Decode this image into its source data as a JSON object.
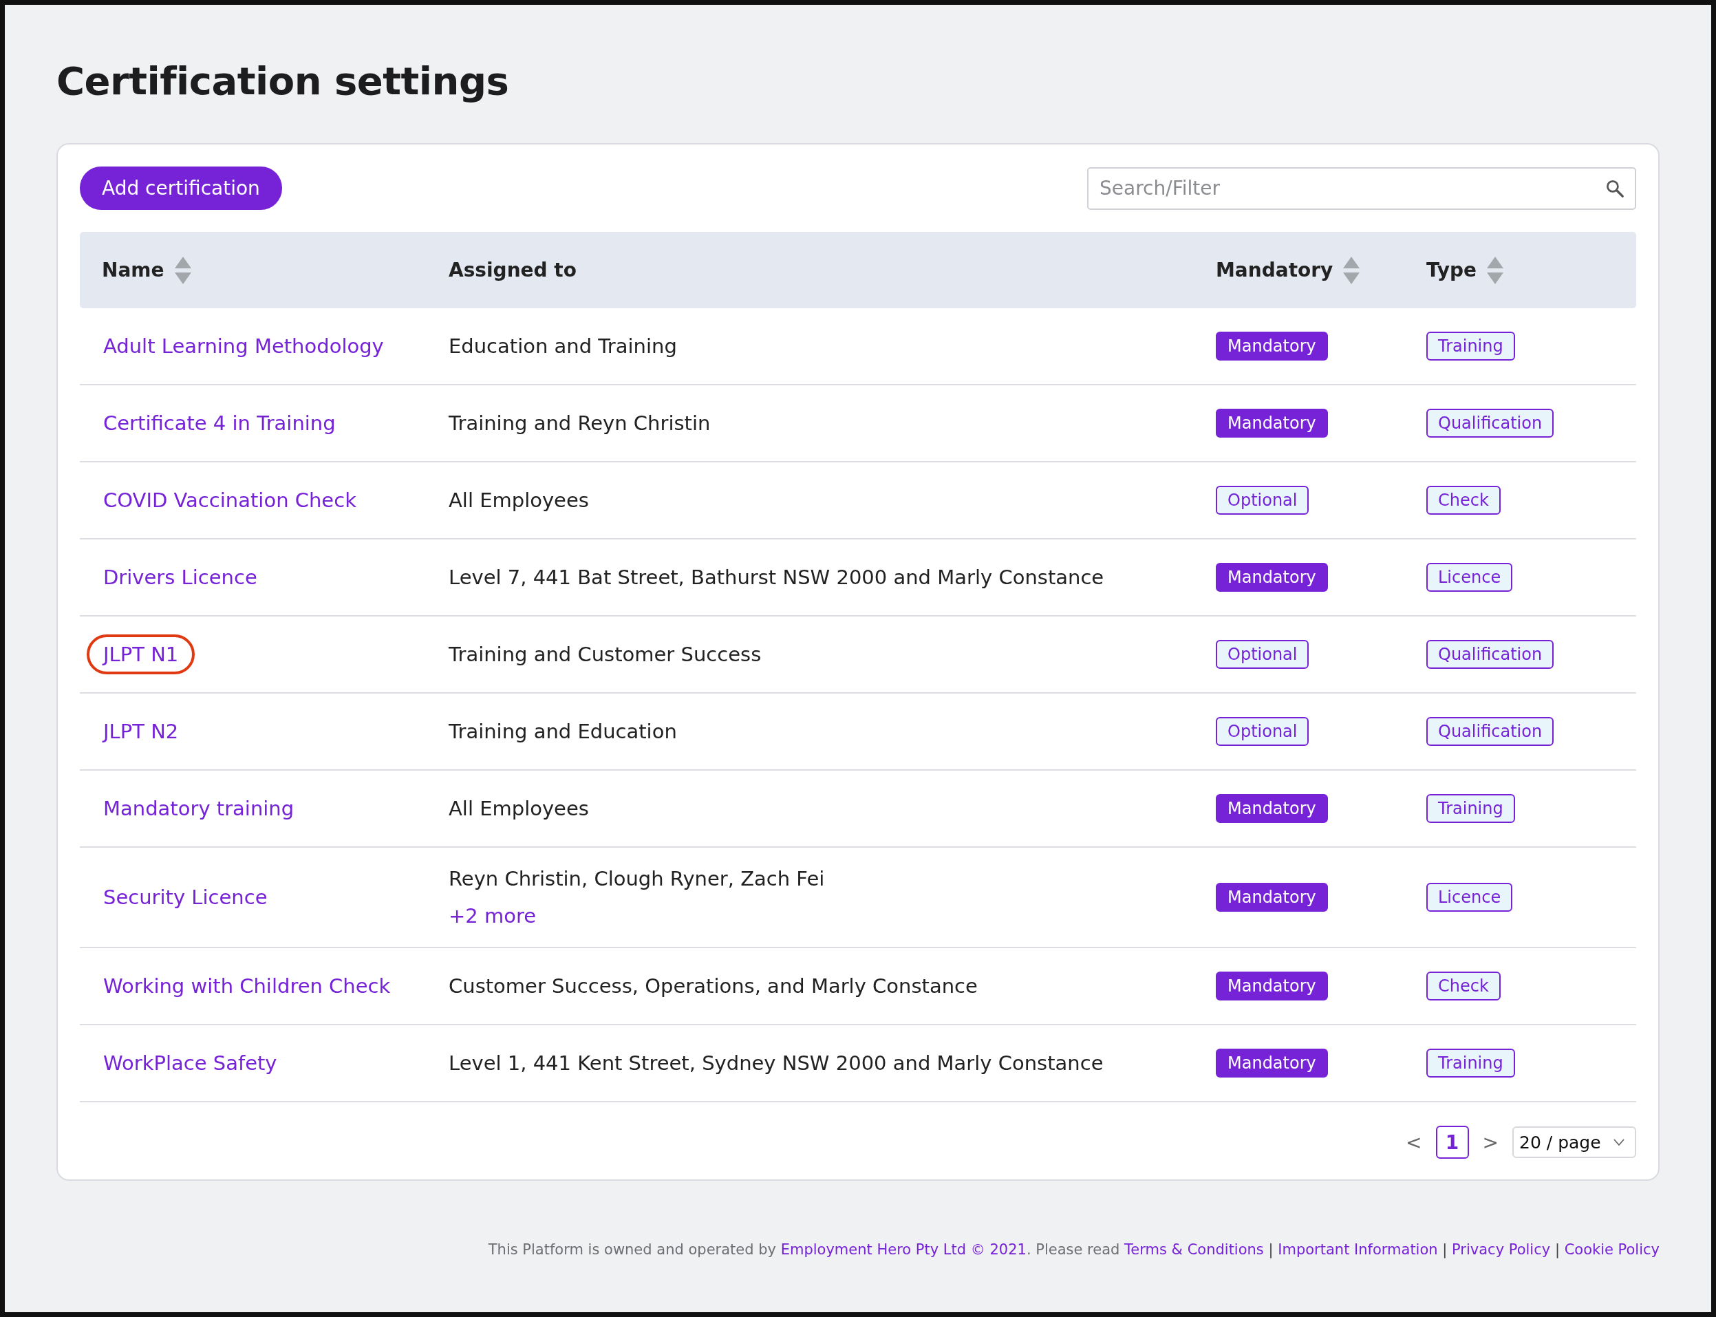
{
  "page": {
    "title": "Certification settings"
  },
  "toolbar": {
    "add_button": "Add certification",
    "search": {
      "placeholder": "Search/Filter"
    }
  },
  "table": {
    "columns": [
      {
        "label": "Name",
        "sortable": true
      },
      {
        "label": "Assigned to",
        "sortable": false
      },
      {
        "label": "Mandatory",
        "sortable": true
      },
      {
        "label": "Type",
        "sortable": true
      }
    ],
    "rows": [
      {
        "name": "Adult Learning Methodology",
        "highlighted": false,
        "assigned": [
          "Education and Training"
        ],
        "more": null,
        "requirement": {
          "label": "Mandatory",
          "kind": "mandatory"
        },
        "type": "Training"
      },
      {
        "name": "Certificate 4 in Training",
        "highlighted": false,
        "assigned": [
          "Training and Reyn Christin"
        ],
        "more": null,
        "requirement": {
          "label": "Mandatory",
          "kind": "mandatory"
        },
        "type": "Qualification"
      },
      {
        "name": "COVID Vaccination Check",
        "highlighted": false,
        "assigned": [
          "All Employees"
        ],
        "more": null,
        "requirement": {
          "label": "Optional",
          "kind": "optional"
        },
        "type": "Check"
      },
      {
        "name": "Drivers Licence",
        "highlighted": false,
        "assigned": [
          "Level 7, 441 Bat Street, Bathurst NSW 2000 and Marly Constance"
        ],
        "more": null,
        "requirement": {
          "label": "Mandatory",
          "kind": "mandatory"
        },
        "type": "Licence"
      },
      {
        "name": "JLPT N1",
        "highlighted": true,
        "assigned": [
          "Training and Customer Success"
        ],
        "more": null,
        "requirement": {
          "label": "Optional",
          "kind": "optional"
        },
        "type": "Qualification"
      },
      {
        "name": "JLPT N2",
        "highlighted": false,
        "assigned": [
          "Training and Education"
        ],
        "more": null,
        "requirement": {
          "label": "Optional",
          "kind": "optional"
        },
        "type": "Qualification"
      },
      {
        "name": "Mandatory training",
        "highlighted": false,
        "assigned": [
          "All Employees"
        ],
        "more": null,
        "requirement": {
          "label": "Mandatory",
          "kind": "mandatory"
        },
        "type": "Training"
      },
      {
        "name": "Security Licence",
        "highlighted": false,
        "assigned": [
          "Reyn Christin, Clough Ryner, Zach Fei"
        ],
        "more": "+2 more",
        "requirement": {
          "label": "Mandatory",
          "kind": "mandatory"
        },
        "type": "Licence"
      },
      {
        "name": "Working with Children Check",
        "highlighted": false,
        "assigned": [
          "Customer Success, Operations, and Marly Constance"
        ],
        "more": null,
        "requirement": {
          "label": "Mandatory",
          "kind": "mandatory"
        },
        "type": "Check"
      },
      {
        "name": "WorkPlace Safety",
        "highlighted": false,
        "assigned": [
          "Level 1, 441 Kent Street, Sydney NSW 2000 and Marly Constance"
        ],
        "more": null,
        "requirement": {
          "label": "Mandatory",
          "kind": "mandatory"
        },
        "type": "Training"
      }
    ]
  },
  "pagination": {
    "prev": "<",
    "pages": [
      {
        "label": "1",
        "selected": true
      }
    ],
    "next": ">",
    "page_size": "20 / page"
  },
  "footer": {
    "parts": [
      {
        "kind": "text",
        "text": "This Platform is owned and operated by"
      },
      {
        "kind": "link",
        "text": "Employment Hero Pty Ltd © 2021"
      },
      {
        "kind": "text",
        "text": ". Please read"
      },
      {
        "kind": "link",
        "text": "Terms & Conditions"
      },
      {
        "kind": "sep",
        "text": "|"
      },
      {
        "kind": "link",
        "text": "Important Information"
      },
      {
        "kind": "sep",
        "text": "|"
      },
      {
        "kind": "link",
        "text": "Privacy Policy"
      },
      {
        "kind": "sep",
        "text": "|"
      },
      {
        "kind": "link",
        "text": "Cookie Policy"
      }
    ]
  }
}
